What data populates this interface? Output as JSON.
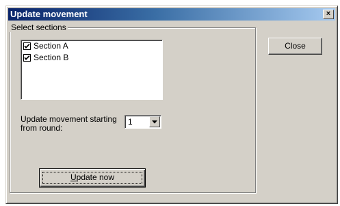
{
  "window": {
    "title": "Update movement",
    "close_glyph": "×"
  },
  "sections_group": {
    "legend": "Select sections",
    "items": [
      {
        "label": "Section A",
        "checked": true
      },
      {
        "label": "Section B",
        "checked": true
      }
    ]
  },
  "round_field": {
    "label_line1": "Update movement starting",
    "label_line2": "from round:",
    "value": "1"
  },
  "buttons": {
    "close_label": "Close",
    "update_mnemonic": "U",
    "update_rest": "pdate now"
  },
  "colors": {
    "dialog_bg": "#d4d0c8",
    "title_start": "#0a246a",
    "title_end": "#a6caf0"
  },
  "icons": {
    "checkbox": "checkmark-icon",
    "dropdown": "chevron-down-icon",
    "close": "close-icon"
  }
}
